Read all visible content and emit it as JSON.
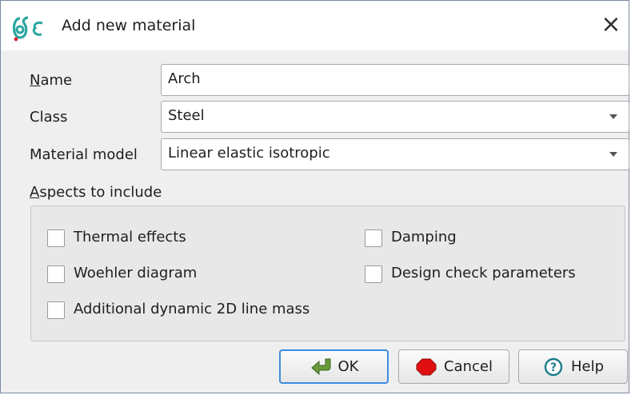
{
  "window": {
    "title": "Add new material",
    "app_logo_text": "σε"
  },
  "form": {
    "name": {
      "label": "Name",
      "value": "Arch"
    },
    "class": {
      "label": "Class",
      "value": "Steel"
    },
    "material_model": {
      "label": "Material model",
      "value": "Linear elastic isotropic"
    }
  },
  "aspects": {
    "label": "Aspects to include",
    "items": [
      {
        "label": "Thermal effects",
        "checked": false
      },
      {
        "label": "Damping",
        "checked": false
      },
      {
        "label": "Woehler diagram",
        "checked": false
      },
      {
        "label": "Design check parameters",
        "checked": false
      },
      {
        "label": "Additional dynamic 2D line mass",
        "checked": false
      }
    ]
  },
  "buttons": {
    "ok": "OK",
    "cancel": "Cancel",
    "help": "Help"
  },
  "colors": {
    "accent": "#3d8be0",
    "logo_teal": "#2aa7a0",
    "logo_red": "#d8282f",
    "cancel_red": "#e01010"
  }
}
